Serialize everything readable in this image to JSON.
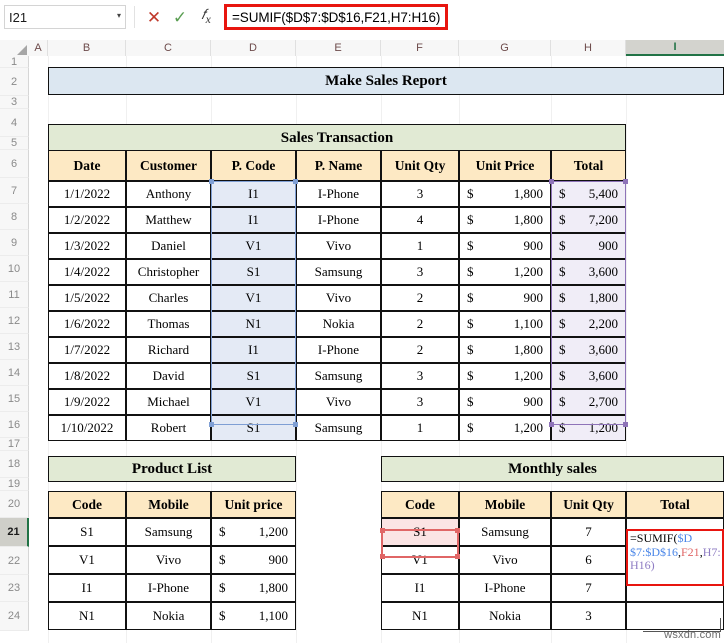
{
  "formula_bar": {
    "name_box_value": "I21",
    "cancel_icon": "x-icon",
    "enter_icon": "check-icon",
    "fx_icon": "fx-icon",
    "chevron_icon": "chevron-down-icon",
    "formula": "=SUMIF($D$7:$D$16,F21,H7:H16)"
  },
  "grid": {
    "columns": [
      "A",
      "B",
      "C",
      "D",
      "E",
      "F",
      "G",
      "H",
      "I"
    ],
    "active_column": "I",
    "rows": [
      "1",
      "2",
      "3",
      "4",
      "5",
      "6",
      "7",
      "8",
      "9",
      "10",
      "11",
      "12",
      "13",
      "14",
      "15",
      "16",
      "17",
      "18",
      "19",
      "20",
      "21",
      "22",
      "23",
      "24"
    ],
    "active_row": "21"
  },
  "banners": {
    "main_title": "Make Sales Report",
    "sales_transaction": "Sales Transaction",
    "product_list": "Product List",
    "monthly_sales": "Monthly sales"
  },
  "sales_table": {
    "headers": [
      "Date",
      "Customer",
      "P. Code",
      "P. Name",
      "Unit Qty",
      "Unit Price",
      "Total"
    ],
    "rows": [
      {
        "date": "1/1/2022",
        "customer": "Anthony",
        "code": "I1",
        "name": "I-Phone",
        "qty": "3",
        "price": "1,800",
        "total": "5,400"
      },
      {
        "date": "1/2/2022",
        "customer": "Matthew",
        "code": "I1",
        "name": "I-Phone",
        "qty": "4",
        "price": "1,800",
        "total": "7,200"
      },
      {
        "date": "1/3/2022",
        "customer": "Daniel",
        "code": "V1",
        "name": "Vivo",
        "qty": "1",
        "price": "900",
        "total": "900"
      },
      {
        "date": "1/4/2022",
        "customer": "Christopher",
        "code": "S1",
        "name": "Samsung",
        "qty": "3",
        "price": "1,200",
        "total": "3,600"
      },
      {
        "date": "1/5/2022",
        "customer": "Charles",
        "code": "V1",
        "name": "Vivo",
        "qty": "2",
        "price": "900",
        "total": "1,800"
      },
      {
        "date": "1/6/2022",
        "customer": "Thomas",
        "code": "N1",
        "name": "Nokia",
        "qty": "2",
        "price": "1,100",
        "total": "2,200"
      },
      {
        "date": "1/7/2022",
        "customer": "Richard",
        "code": "I1",
        "name": "I-Phone",
        "qty": "2",
        "price": "1,800",
        "total": "3,600"
      },
      {
        "date": "1/8/2022",
        "customer": "David",
        "code": "S1",
        "name": "Samsung",
        "qty": "3",
        "price": "1,200",
        "total": "3,600"
      },
      {
        "date": "1/9/2022",
        "customer": "Michael",
        "code": "V1",
        "name": "Vivo",
        "qty": "3",
        "price": "900",
        "total": "2,700"
      },
      {
        "date": "1/10/2022",
        "customer": "Robert",
        "code": "S1",
        "name": "Samsung",
        "qty": "1",
        "price": "1,200",
        "total": "1,200"
      }
    ],
    "currency_symbol": "$"
  },
  "product_list": {
    "headers": [
      "Code",
      "Mobile",
      "Unit price"
    ],
    "rows": [
      {
        "code": "S1",
        "mobile": "Samsung",
        "price": "1,200"
      },
      {
        "code": "V1",
        "mobile": "Vivo",
        "price": "900"
      },
      {
        "code": "I1",
        "mobile": "I-Phone",
        "price": "1,800"
      },
      {
        "code": "N1",
        "mobile": "Nokia",
        "price": "1,100"
      }
    ],
    "currency_symbol": "$"
  },
  "monthly_sales": {
    "headers": [
      "Code",
      "Mobile",
      "Unit Qty",
      "Total"
    ],
    "rows": [
      {
        "code": "S1",
        "mobile": "Samsung",
        "qty": "7",
        "total": ""
      },
      {
        "code": "V1",
        "mobile": "Vivo",
        "qty": "6",
        "total": ""
      },
      {
        "code": "I1",
        "mobile": "I-Phone",
        "qty": "7",
        "total": ""
      },
      {
        "code": "N1",
        "mobile": "Nokia",
        "qty": "3",
        "total": ""
      }
    ],
    "editing_cell_formula": {
      "prefix": "=SUMIF(",
      "arg1": "$D$7:$D$16",
      "sep1": ",",
      "arg2": "F21",
      "sep2": ",",
      "arg3": "H7:H16",
      "suffix": ")"
    }
  },
  "watermark": "wsxdn.com",
  "colors": {
    "title_fill": "#dce7f1",
    "section_fill": "#e1ead4",
    "header_fill": "#fde9c4",
    "total_range_fill": "#f0edf7",
    "code_range_fill": "#e4eaf5",
    "criteria_fill": "#fbe4e4",
    "annotation_red": "#e8150f",
    "excel_green": "#217346"
  }
}
